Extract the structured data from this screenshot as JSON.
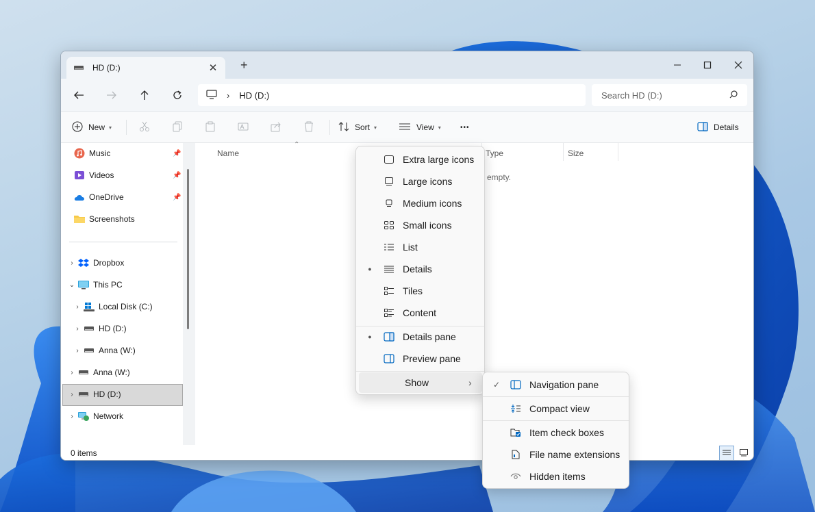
{
  "window": {
    "tab_title": "HD (D:)",
    "new_tab_glyph": "+",
    "close_tab_glyph": "✕"
  },
  "address": {
    "segment": "HD (D:)",
    "search_placeholder": "Search HD (D:)"
  },
  "commands": {
    "new_label": "New",
    "sort_label": "Sort",
    "view_label": "View",
    "more_glyph": "•••",
    "details_label": "Details"
  },
  "sidebar": {
    "quick_access": [
      {
        "label": "Music",
        "icon": "music-icon"
      },
      {
        "label": "Videos",
        "icon": "videos-icon"
      },
      {
        "label": "OneDrive",
        "icon": "onedrive-icon"
      },
      {
        "label": "Screenshots",
        "icon": "folder-icon"
      }
    ],
    "tree": [
      {
        "label": "Dropbox",
        "icon": "dropbox-icon"
      },
      {
        "label": "This PC",
        "icon": "this-pc-icon"
      },
      {
        "label": "Local Disk (C:)",
        "icon": "windows-drive-icon"
      },
      {
        "label": "HD (D:)",
        "icon": "drive-icon"
      },
      {
        "label": "Anna (W:)",
        "icon": "drive-icon"
      },
      {
        "label": "Anna (W:)",
        "icon": "drive-icon"
      },
      {
        "label": "HD (D:)",
        "icon": "drive-icon"
      },
      {
        "label": "Network",
        "icon": "network-icon"
      }
    ]
  },
  "columns": {
    "name": "Name",
    "type": "Type",
    "size": "Size"
  },
  "content": {
    "empty_text": "empty."
  },
  "status": {
    "item_count": "0 items"
  },
  "view_menu": {
    "items": [
      {
        "label": "Extra large icons",
        "checked": false
      },
      {
        "label": "Large icons",
        "checked": false
      },
      {
        "label": "Medium icons",
        "checked": false
      },
      {
        "label": "Small icons",
        "checked": false
      },
      {
        "label": "List",
        "checked": false
      },
      {
        "label": "Details",
        "checked": true
      },
      {
        "label": "Tiles",
        "checked": false
      },
      {
        "label": "Content",
        "checked": false
      }
    ],
    "panes": [
      {
        "label": "Details pane",
        "checked": true
      },
      {
        "label": "Preview pane",
        "checked": false
      }
    ],
    "show_label": "Show"
  },
  "show_menu": {
    "items": [
      {
        "label": "Navigation pane",
        "checked": true
      },
      {
        "label": "Compact view",
        "checked": false
      },
      {
        "label": "Item check boxes",
        "checked": false
      },
      {
        "label": "File name extensions",
        "checked": false
      },
      {
        "label": "Hidden items",
        "checked": false
      }
    ]
  },
  "colors": {
    "accent": "#0067c0",
    "selection_bg": "#d9d9d9",
    "titlebar_bg": "#dde6ef"
  }
}
